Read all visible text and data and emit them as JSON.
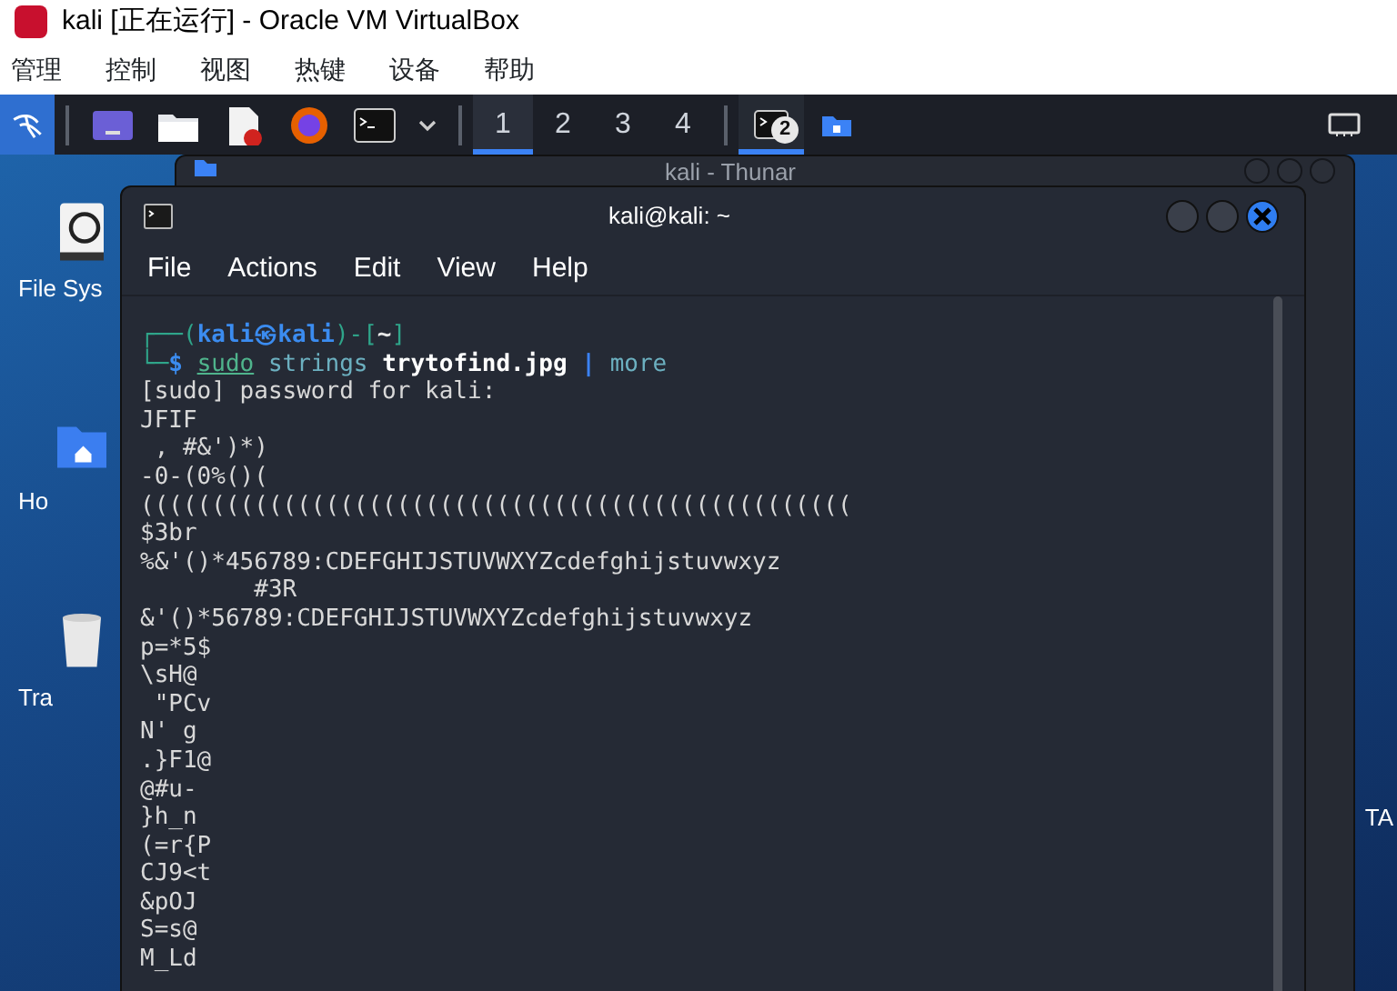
{
  "window": {
    "title": "kali [正在运行] - Oracle VM VirtualBox"
  },
  "menu": [
    "管理",
    "控制",
    "视图",
    "热键",
    "设备",
    "帮助"
  ],
  "panel": {
    "launchers": [
      {
        "kind": "workspace"
      },
      {
        "kind": "files"
      },
      {
        "kind": "editor"
      },
      {
        "kind": "browser"
      },
      {
        "kind": "terminal"
      }
    ],
    "workspaces": [
      {
        "label": "1",
        "selected": true
      },
      {
        "label": "2",
        "selected": false
      },
      {
        "label": "3",
        "selected": false
      },
      {
        "label": "4",
        "selected": false
      }
    ],
    "tasks": [
      {
        "kind": "terminal",
        "badge": "2",
        "selected": true
      },
      {
        "kind": "folder",
        "selected": false
      }
    ]
  },
  "desktop": {
    "icons": [
      {
        "kind": "drive",
        "label": "File Sys"
      },
      {
        "kind": "home",
        "label": "Ho"
      },
      {
        "kind": "trash",
        "label": "Tra"
      }
    ],
    "edge_text": "TA"
  },
  "background_window": {
    "title": "kali - Thunar"
  },
  "terminal": {
    "title": "kali@kali: ~",
    "menu": [
      "File",
      "Actions",
      "Edit",
      "View",
      "Help"
    ],
    "prompt": [
      {
        "kind": "frame",
        "text": "┌──("
      },
      {
        "kind": "user",
        "text": "kali㉿kali"
      },
      {
        "kind": "frame",
        "text": ")-["
      },
      {
        "kind": "path",
        "text": "~"
      },
      {
        "kind": "frame",
        "text": "]"
      }
    ],
    "command": [
      {
        "kind": "frame",
        "text": "└─"
      },
      {
        "kind": "dollar",
        "text": "$ "
      },
      {
        "kind": "sudo",
        "text": "sudo"
      },
      {
        "kind": "arg",
        "text": " strings "
      },
      {
        "kind": "file",
        "text": "trytofind.jpg"
      },
      {
        "kind": "pipe",
        "text": " | "
      },
      {
        "kind": "arg",
        "text": "more"
      }
    ],
    "output": [
      "[sudo] password for kali:",
      "JFIF",
      " , #&')*)",
      "-0-(0%()(",
      "((((((((((((((((((((((((((((((((((((((((((((((((((",
      "$3br",
      "%&'()*456789:CDEFGHIJSTUVWXYZcdefghijstuvwxyz",
      "        #3R",
      "&'()*56789:CDEFGHIJSTUVWXYZcdefghijstuvwxyz",
      "p=*5$",
      "\\sH@",
      " \"PCv",
      "N' g",
      ".}F1@",
      "@#u-",
      "}h_n",
      "(=r{P",
      "CJ9<t",
      "&pOJ",
      "S=s@",
      "M_Ld"
    ]
  }
}
